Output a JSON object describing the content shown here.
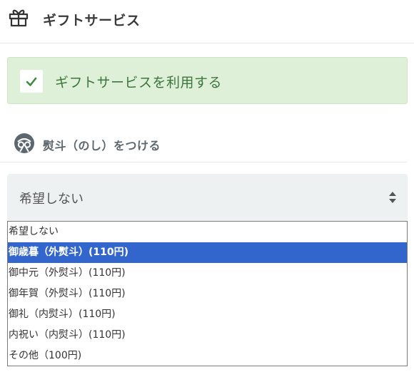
{
  "header": {
    "title": "ギフトサービス",
    "icon": "gift-icon"
  },
  "gift_option": {
    "label": "ギフトサービスを利用する",
    "checked": true,
    "icon": "check-icon",
    "background": "#dff0d8",
    "text_color": "#3c763d"
  },
  "noshi": {
    "title": "熨斗（のし）をつける",
    "icon": "noshi-icon"
  },
  "select": {
    "current_value": "希望しない",
    "icon": "sort-arrows-icon",
    "options": [
      {
        "label": "希望しない"
      },
      {
        "label": "御歳暮（外熨斗）(110円)",
        "highlighted": true
      },
      {
        "label": "御中元（外熨斗）(110円)"
      },
      {
        "label": "御年賀（外熨斗）(110円)"
      },
      {
        "label": "御礼（内熨斗）(110円)"
      },
      {
        "label": "内祝い（内熨斗）(110円)"
      },
      {
        "label": "その他（100円)"
      }
    ],
    "highlight_color": "#3366cc"
  }
}
